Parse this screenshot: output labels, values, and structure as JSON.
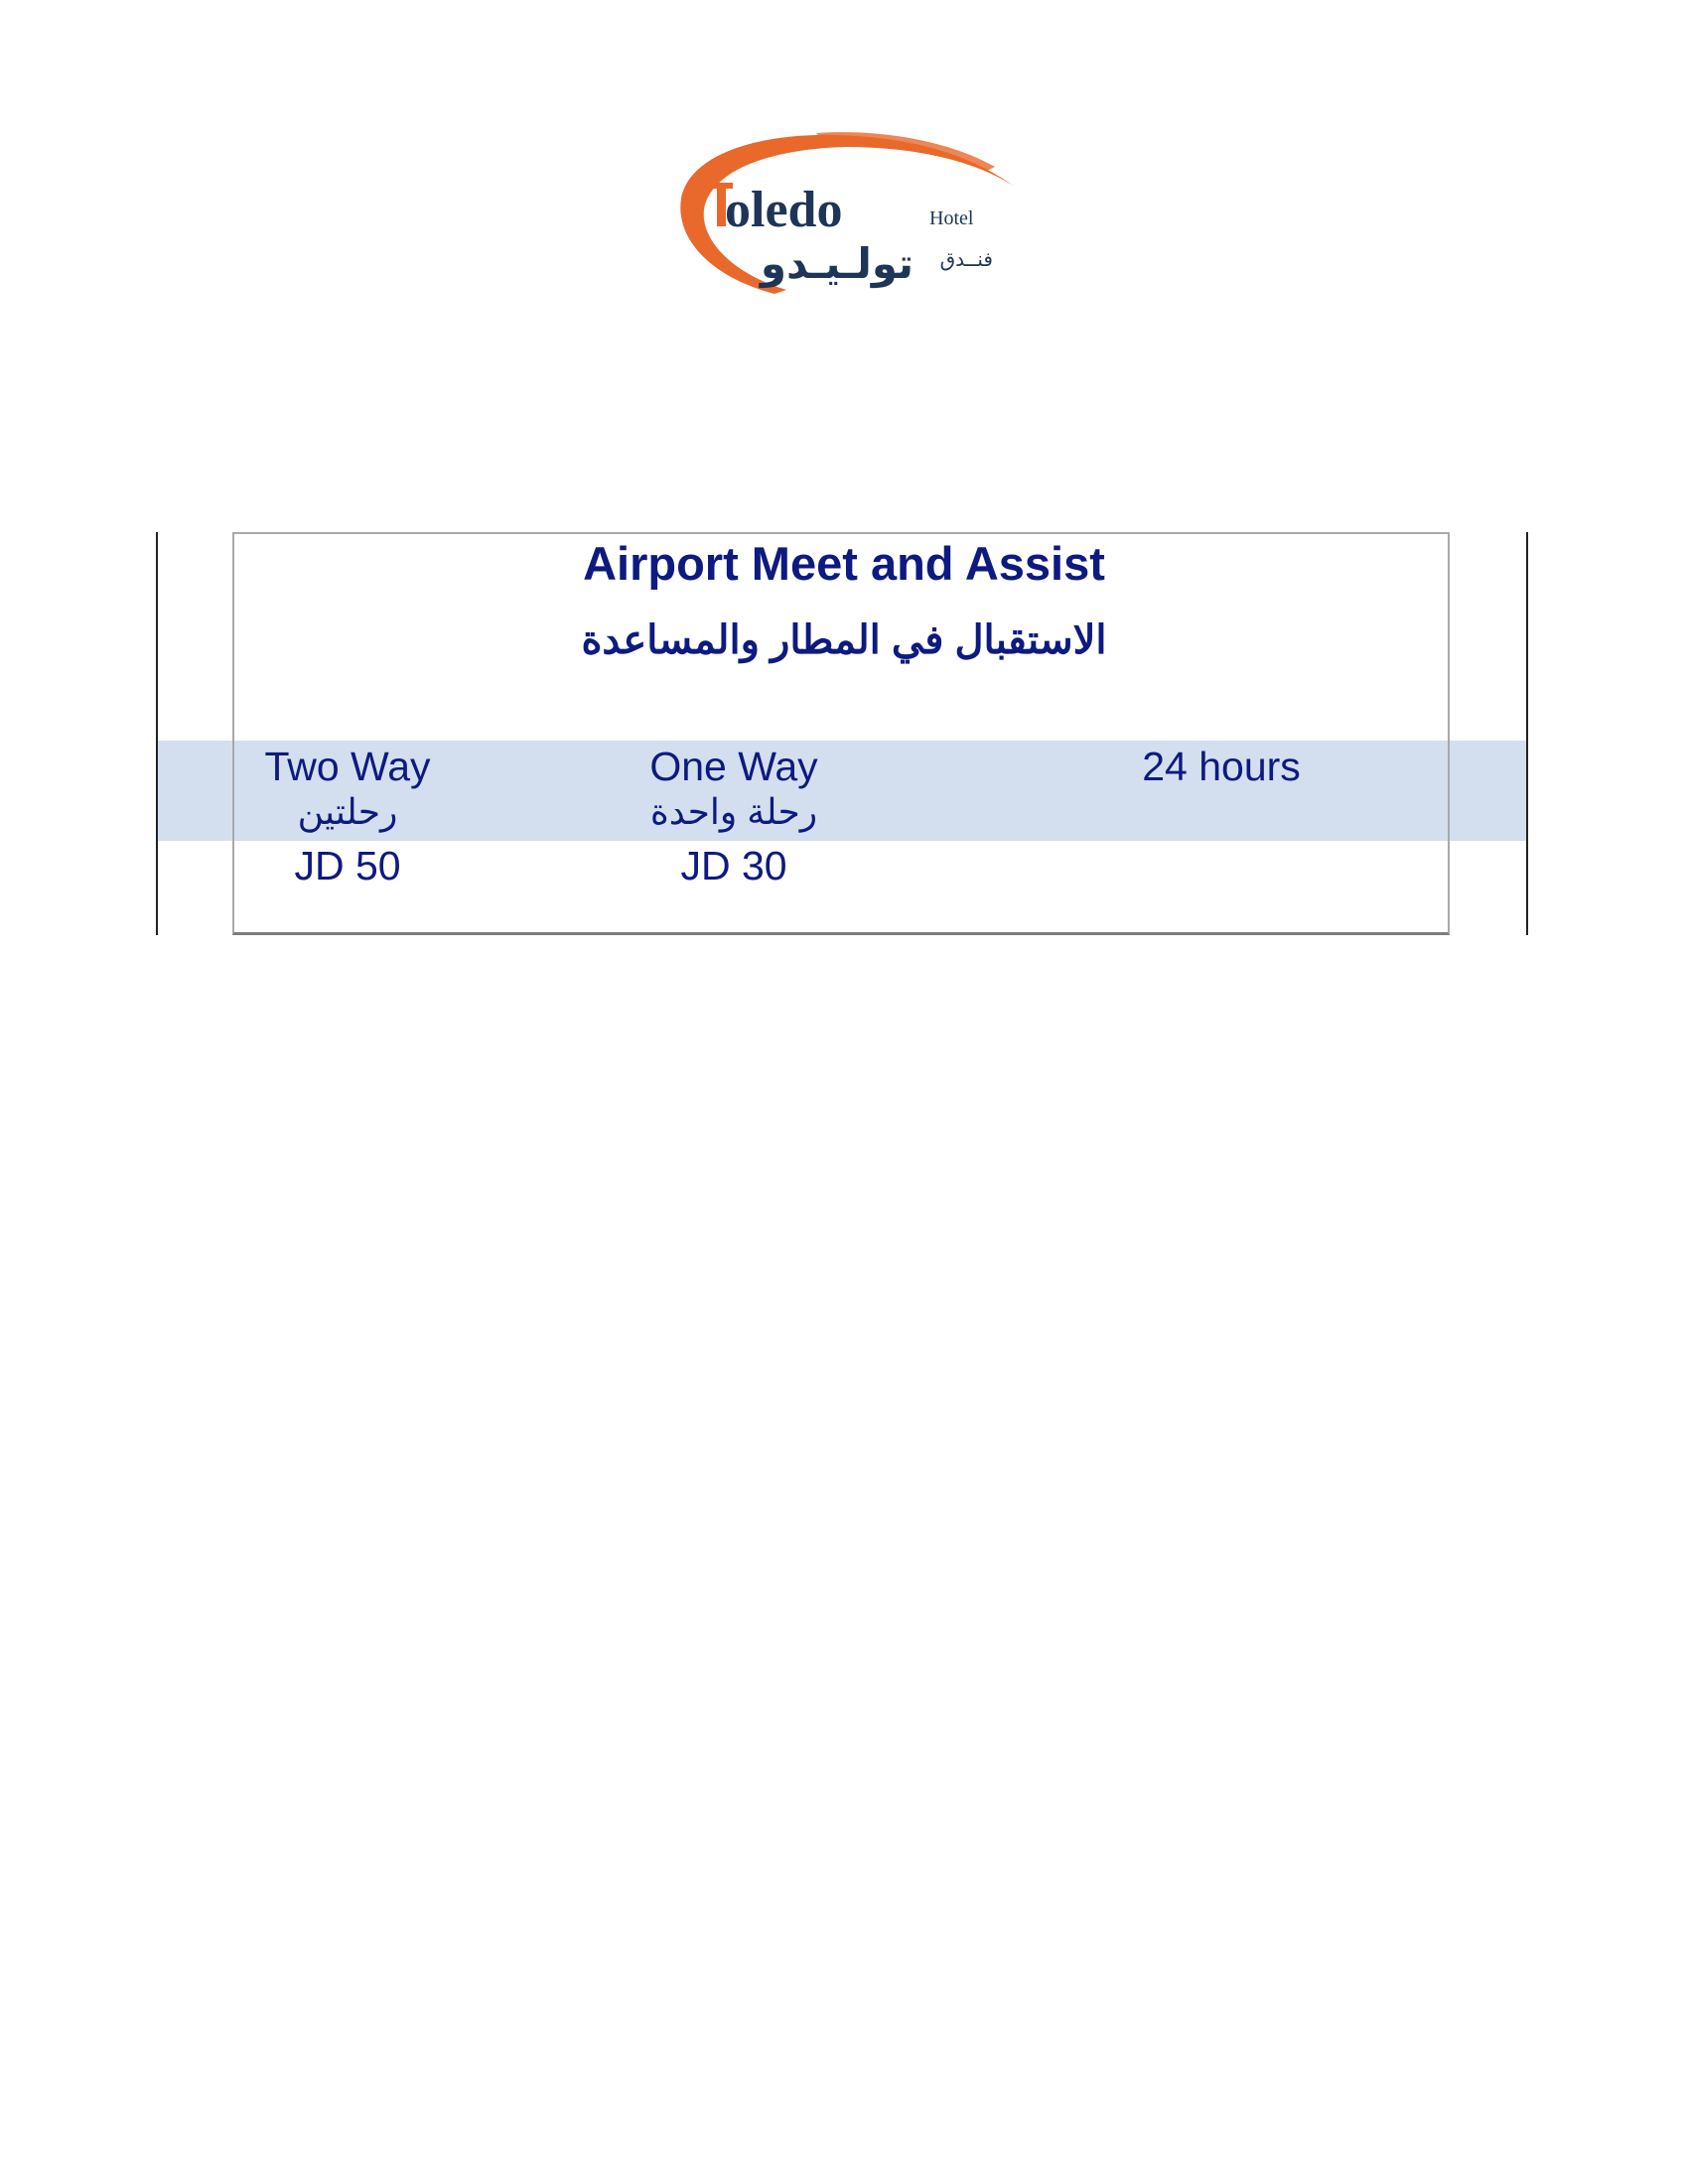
{
  "logo": {
    "brand_name": "Toledo",
    "hotel_en": "Hotel",
    "name_ar": "تولـيـدو",
    "hotel_ar": "فنــدق",
    "colors": {
      "swoosh": "#e8692b",
      "text": "#1e3557"
    }
  },
  "title_en": "Airport Meet and Assist",
  "title_ar": "الاستقبال في المطار والمساعدة",
  "columns": [
    {
      "label_en": "Two Way",
      "label_ar": "رحلتين",
      "price": "JD 50"
    },
    {
      "label_en": "One Way",
      "label_ar": "رحلة واحدة",
      "price": "JD 30"
    },
    {
      "label_en": "24 hours"
    }
  ],
  "colors": {
    "text": "#0d1a80",
    "band": "#d3dfee",
    "box_border": "#a9a9a9"
  }
}
